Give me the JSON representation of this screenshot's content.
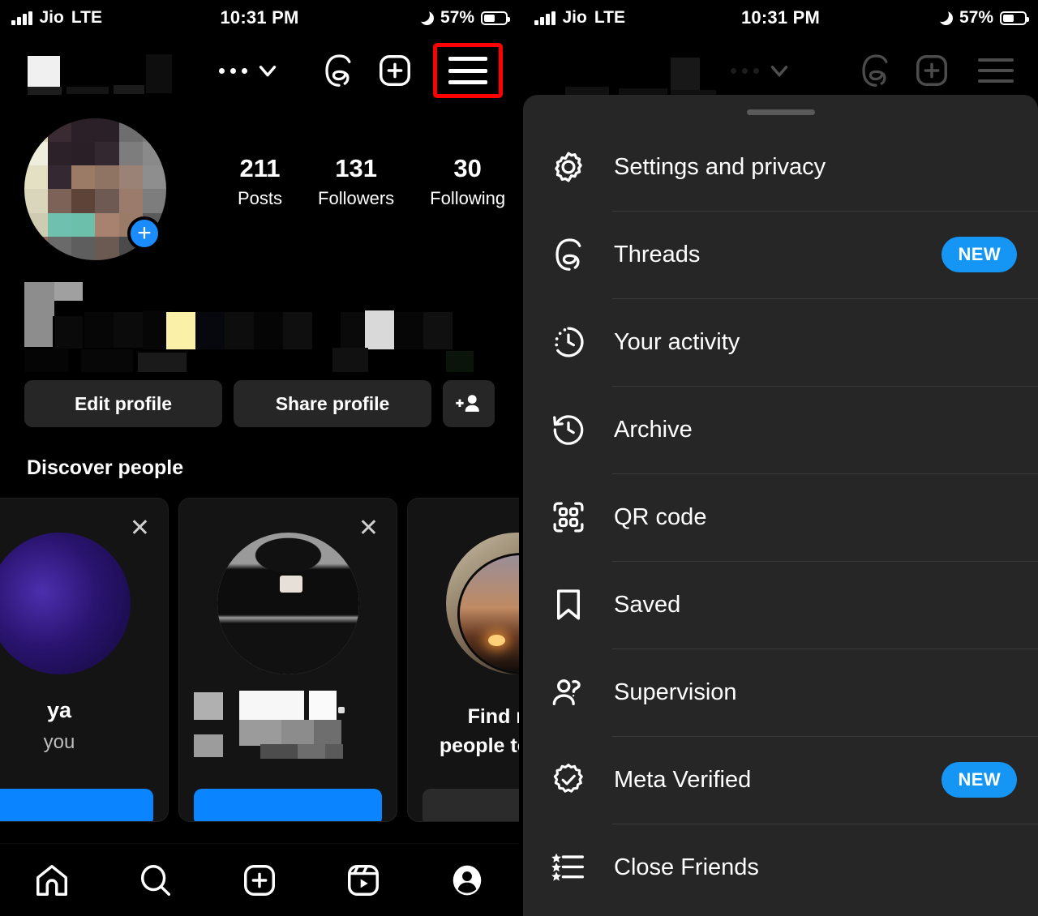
{
  "status_bar": {
    "carrier": "Jio",
    "network": "LTE",
    "time": "10:31 PM",
    "battery_percent": "57%",
    "do_not_disturb_icon": "moon-icon",
    "battery_icon": "battery-icon",
    "signal_icon": "signal-bars-icon"
  },
  "left_screen": {
    "top_nav": {
      "username": "",
      "more_icon": "ellipsis-icon",
      "chevron_icon": "chevron-down-icon",
      "threads_icon": "threads-icon",
      "create_icon": "plus-square-icon",
      "menu_icon": "hamburger-menu-icon",
      "highlight_color": "#FF0000"
    },
    "profile": {
      "avatar_icon": "profile-avatar",
      "add_story_icon": "plus-icon",
      "stats": [
        {
          "num": "211",
          "label": "Posts"
        },
        {
          "num": "131",
          "label": "Followers"
        },
        {
          "num": "30",
          "label": "Following"
        }
      ],
      "bio": "",
      "buttons": {
        "edit_profile": "Edit profile",
        "share_profile": "Share profile",
        "add_person_icon": "add-person-icon"
      }
    },
    "discover": {
      "title": "Discover people",
      "cards": [
        {
          "name": "ya",
          "subtitle": "you",
          "close_icon": "close-icon",
          "cta_style": "blue"
        },
        {
          "name": "",
          "subtitle": "",
          "close_icon": "close-icon",
          "cta_style": "blue"
        },
        {
          "name": "Find more",
          "subtitle": "people to follow",
          "close_icon": "",
          "cta_style": "grey"
        }
      ]
    },
    "tab_bar": [
      {
        "icon": "home-icon",
        "label": "Home"
      },
      {
        "icon": "search-icon",
        "label": "Search"
      },
      {
        "icon": "create-plus-icon",
        "label": "Create"
      },
      {
        "icon": "reels-icon",
        "label": "Reels"
      },
      {
        "icon": "profile-icon",
        "label": "Profile"
      }
    ]
  },
  "right_screen": {
    "top_nav": {
      "more_icon": "ellipsis-icon",
      "chevron_icon": "chevron-down-icon",
      "threads_icon": "threads-icon",
      "create_icon": "plus-square-icon",
      "menu_icon": "hamburger-menu-icon"
    },
    "sheet": {
      "grabber_icon": "drag-handle",
      "items": [
        {
          "label": "Settings and privacy",
          "icon": "gear-icon",
          "badge": ""
        },
        {
          "label": "Threads",
          "icon": "threads-icon",
          "badge": "NEW"
        },
        {
          "label": "Your activity",
          "icon": "activity-clock-icon",
          "badge": ""
        },
        {
          "label": "Archive",
          "icon": "archive-clock-icon",
          "badge": ""
        },
        {
          "label": "QR code",
          "icon": "qr-code-icon",
          "badge": ""
        },
        {
          "label": "Saved",
          "icon": "bookmark-icon",
          "badge": ""
        },
        {
          "label": "Supervision",
          "icon": "people-icon",
          "badge": ""
        },
        {
          "label": "Meta Verified",
          "icon": "verified-badge-icon",
          "badge": "NEW"
        },
        {
          "label": "Close Friends",
          "icon": "close-friends-list-icon",
          "badge": ""
        }
      ]
    },
    "annotation": {
      "arrow_icon": "red-arrow-icon",
      "arrow_color": "#F01B1B",
      "points_to": "Settings and privacy"
    }
  },
  "colors": {
    "background": "#000000",
    "sheet_background": "#262626",
    "accent_blue": "#1596F5",
    "annotation_red": "#FF0000",
    "button_grey": "#262626",
    "divider": "#3A3A3A"
  }
}
